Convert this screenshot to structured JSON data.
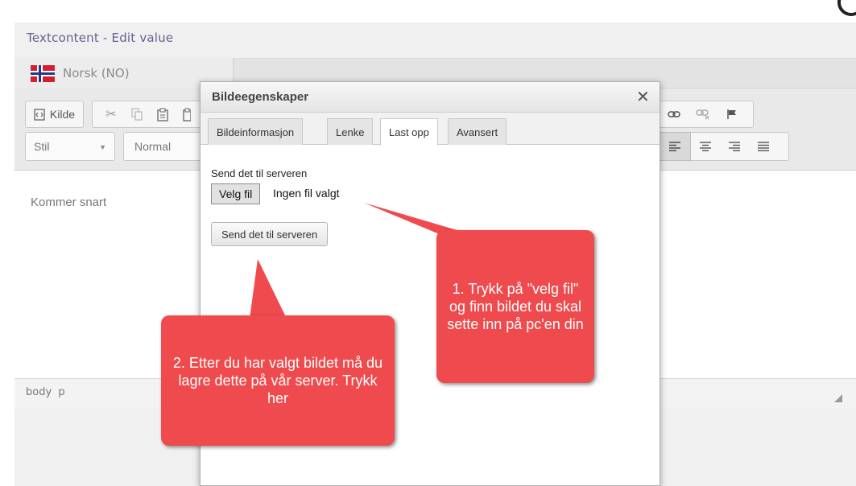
{
  "panel": {
    "title": "Textcontent - Edit value",
    "language_tab": "Norsk (NO)"
  },
  "toolbar": {
    "source_label": "Kilde",
    "style_select": "Stil",
    "format_select": "Normal"
  },
  "editor": {
    "content": "Kommer snart",
    "status_path": "body  p"
  },
  "dialog": {
    "title": "Bildeegenskaper",
    "close_label": "✕",
    "tabs": [
      {
        "label": "Bildeinformasjon",
        "active": false
      },
      {
        "label": "Lenke",
        "active": false
      },
      {
        "label": "Last opp",
        "active": true
      },
      {
        "label": "Avansert",
        "active": false
      }
    ],
    "upload_label": "Send det til serveren",
    "file_button": "Velg fil",
    "file_status": "Ingen fil valgt",
    "send_button": "Send det til serveren"
  },
  "callouts": {
    "step1": "1. Trykk på \"velg fil\" og finn bildet du skal sette inn på pc'en din",
    "step2": "2. Etter du har valgt bildet må du lagre dette på vår server. Trykk her"
  },
  "colors": {
    "callout": "#ef4b4e",
    "title_accent": "#6a5d93",
    "flag_red": "#d32030",
    "flag_blue": "#1d3b8c"
  }
}
